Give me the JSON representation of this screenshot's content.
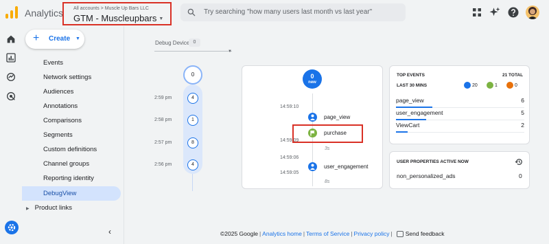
{
  "app": {
    "title": "Analytics",
    "account_crumb": "All accounts > Muscle Up Bars LLC",
    "property_name": "GTM - Muscleupbars",
    "search_placeholder": "Try searching \"how many users last month vs last year\""
  },
  "header_icons": [
    "apps-grid-icon",
    "sparkle-icon",
    "help-icon",
    "avatar"
  ],
  "rail_icons": [
    "home-icon",
    "reports-icon",
    "explore-icon",
    "advertising-icon",
    "settings-gear-icon"
  ],
  "sidebar": {
    "create_label": "Create",
    "items": [
      {
        "label": "Events",
        "active": false
      },
      {
        "label": "Network settings",
        "active": false
      },
      {
        "label": "Audiences",
        "active": false
      },
      {
        "label": "Annotations",
        "active": false
      },
      {
        "label": "Comparisons",
        "active": false
      },
      {
        "label": "Segments",
        "active": false
      },
      {
        "label": "Custom definitions",
        "active": false
      },
      {
        "label": "Channel groups",
        "active": false
      },
      {
        "label": "Reporting identity",
        "active": false
      },
      {
        "label": "DebugView",
        "active": true
      }
    ],
    "product_links": "Product links"
  },
  "debug": {
    "device_label": "Debug Device",
    "device_count": "0",
    "minutes_top": "0",
    "minutes": [
      {
        "time": "2:59 pm",
        "count": "4"
      },
      {
        "time": "2:58 pm",
        "count": "1"
      },
      {
        "time": "2:57 pm",
        "count": "8"
      },
      {
        "time": "2:56 pm",
        "count": "4"
      }
    ]
  },
  "stream": {
    "new_count": "0",
    "new_label": "new",
    "times": [
      "14:59:10",
      "14:59:09",
      "14:59:06",
      "14:59:05"
    ],
    "events": [
      {
        "name": "page_view",
        "color": "#1a73e8"
      },
      {
        "name": "purchase",
        "color": "#7cb342"
      },
      {
        "name": "user_engagement",
        "color": "#1a73e8"
      }
    ],
    "gaps": [
      "3s",
      "8s"
    ]
  },
  "top_events": {
    "title": "TOP EVENTS",
    "total": "21 TOTAL",
    "subtitle": "LAST 30 MINS",
    "stats": [
      {
        "value": "20",
        "color": "#1a73e8"
      },
      {
        "value": "1",
        "color": "#7cb342"
      },
      {
        "value": "0",
        "color": "#e8710a"
      }
    ],
    "rows": [
      {
        "name": "page_view",
        "value": "6",
        "share": 1.0
      },
      {
        "name": "user_engagement",
        "value": "5",
        "share": 0.83
      },
      {
        "name": "ViewCart",
        "value": "2",
        "share": 0.33
      }
    ]
  },
  "user_properties": {
    "title": "USER PROPERTIES ACTIVE NOW",
    "name": "non_personalized_ads",
    "value": "0"
  },
  "footer": {
    "copyright": "©2025 Google",
    "analytics_home": "Analytics home",
    "terms": "Terms of Service",
    "privacy": "Privacy policy",
    "feedback": "Send feedback",
    "separator": "|"
  }
}
